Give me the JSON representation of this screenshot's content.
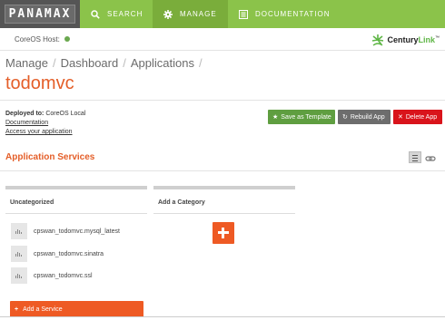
{
  "nav": {
    "brand": "PANAMAX",
    "items": [
      {
        "label": "SEARCH",
        "icon": "search-icon"
      },
      {
        "label": "MANAGE",
        "icon": "gear-icon"
      },
      {
        "label": "DOCUMENTATION",
        "icon": "document-icon"
      }
    ],
    "active": "MANAGE"
  },
  "host": {
    "label": "CoreOS Host:",
    "status_color": "#6aa84f"
  },
  "logo": {
    "text_part1": "Century",
    "text_part2": "Link",
    "tm": "™"
  },
  "breadcrumb": [
    "Manage",
    "Dashboard",
    "Applications"
  ],
  "app": {
    "title": "todomvc",
    "deployed_label": "Deployed to:",
    "deployed_value": "CoreOS Local",
    "documentation_link": "Documentation",
    "access_link": "Access your application"
  },
  "buttons": {
    "save_template": "Save as Template",
    "rebuild": "Rebuild App",
    "delete": "Delete App"
  },
  "services": {
    "title": "Application Services",
    "categories": [
      {
        "name": "Uncategorized",
        "items": [
          "cpswan_todomvc.mysql_latest",
          "cpswan_todomvc.sinatra",
          "cpswan_todomvc.ssl"
        ],
        "add_label": "Add a Service"
      }
    ],
    "add_category_label": "Add a Category"
  },
  "colors": {
    "nav_green": "#8bc34a",
    "accent_orange": "#e45e28",
    "save_green": "#5f9e40",
    "rebuild_gray": "#6d6d6d",
    "delete_red": "#d9141b"
  }
}
